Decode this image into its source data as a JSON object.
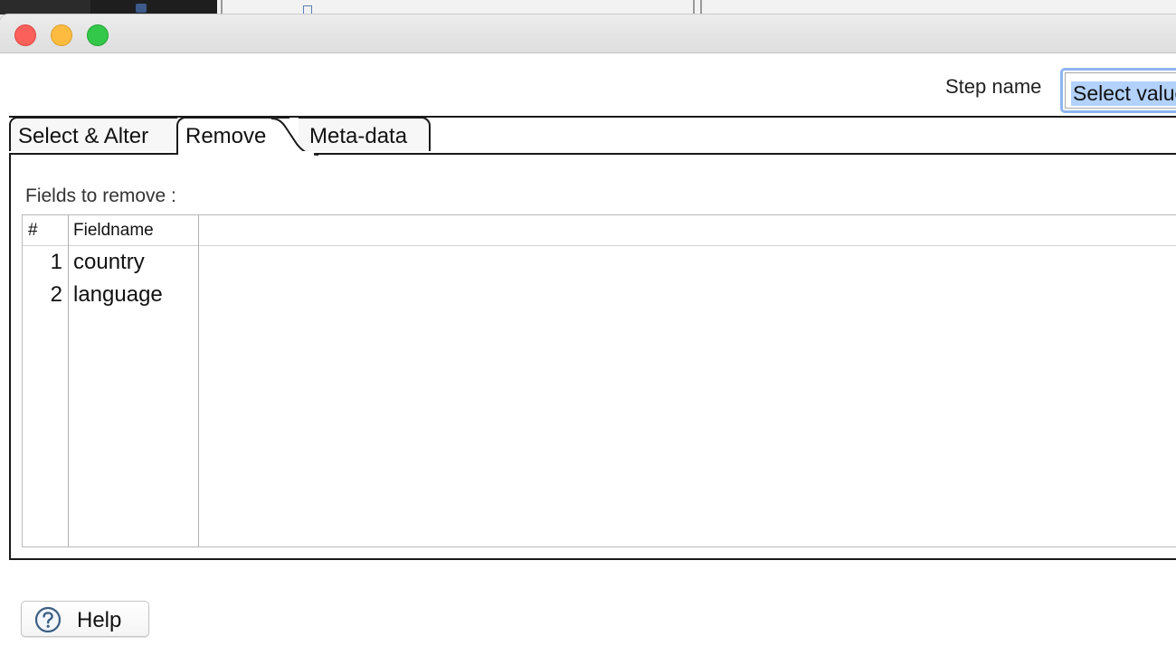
{
  "dialog": {
    "step_name_label": "Step name",
    "step_name_value": "Select values"
  },
  "tabs": [
    {
      "label": "Select & Alter",
      "active": false
    },
    {
      "label": "Remove",
      "active": true
    },
    {
      "label": "Meta-data",
      "active": false
    }
  ],
  "remove_tab": {
    "fields_label": "Fields to remove :",
    "columns": [
      "#",
      "Fieldname"
    ],
    "rows": [
      {
        "num": "1",
        "fieldname": "country"
      },
      {
        "num": "2",
        "fieldname": "language"
      }
    ]
  },
  "footer": {
    "help_label": "Help"
  },
  "colors": {
    "close": "#fc605b",
    "minimize": "#fdbc40",
    "maximize": "#34c84a",
    "focus_ring": "#8fb4ef",
    "selection": "#b2d1fb"
  },
  "icons": {
    "help": "question-circle-icon"
  }
}
